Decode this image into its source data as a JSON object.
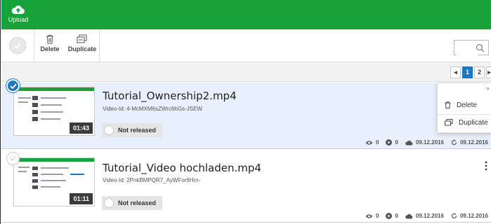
{
  "topbar": {
    "upload_label": "Upload"
  },
  "toolbar": {
    "delete_label": "Delete",
    "duplicate_label": "Duplicate",
    "search_placeholder": ""
  },
  "pagination": {
    "pages": [
      "1",
      "2"
    ],
    "active": "1"
  },
  "videos": [
    {
      "title": "Tutorial_Ownership2.mp4",
      "video_id": "Video-Id: 4-McMXM6sZWrc6hGs-JSEW",
      "duration": "01:43",
      "status": "Not released",
      "views": "0",
      "plays": "0",
      "uploaded": "09.12.2016",
      "updated": "09.12.2016",
      "selected": true
    },
    {
      "title": "Tutorial_Video hochladen.mp4",
      "video_id": "Video-Id: 2PnkBMPQR7_AyWFor6Hrn-",
      "duration": "01:11",
      "status": "Not released",
      "views": "0",
      "plays": "0",
      "uploaded": "09.12.2016",
      "updated": "09.12.2016",
      "selected": false
    }
  ],
  "menu": {
    "close": "»",
    "delete_label": "Delete",
    "duplicate_label": "Duplicate"
  },
  "colors": {
    "brand_green": "#18a33a",
    "accent_blue": "#1b78c5",
    "selected_row": "#e8f1fb"
  }
}
